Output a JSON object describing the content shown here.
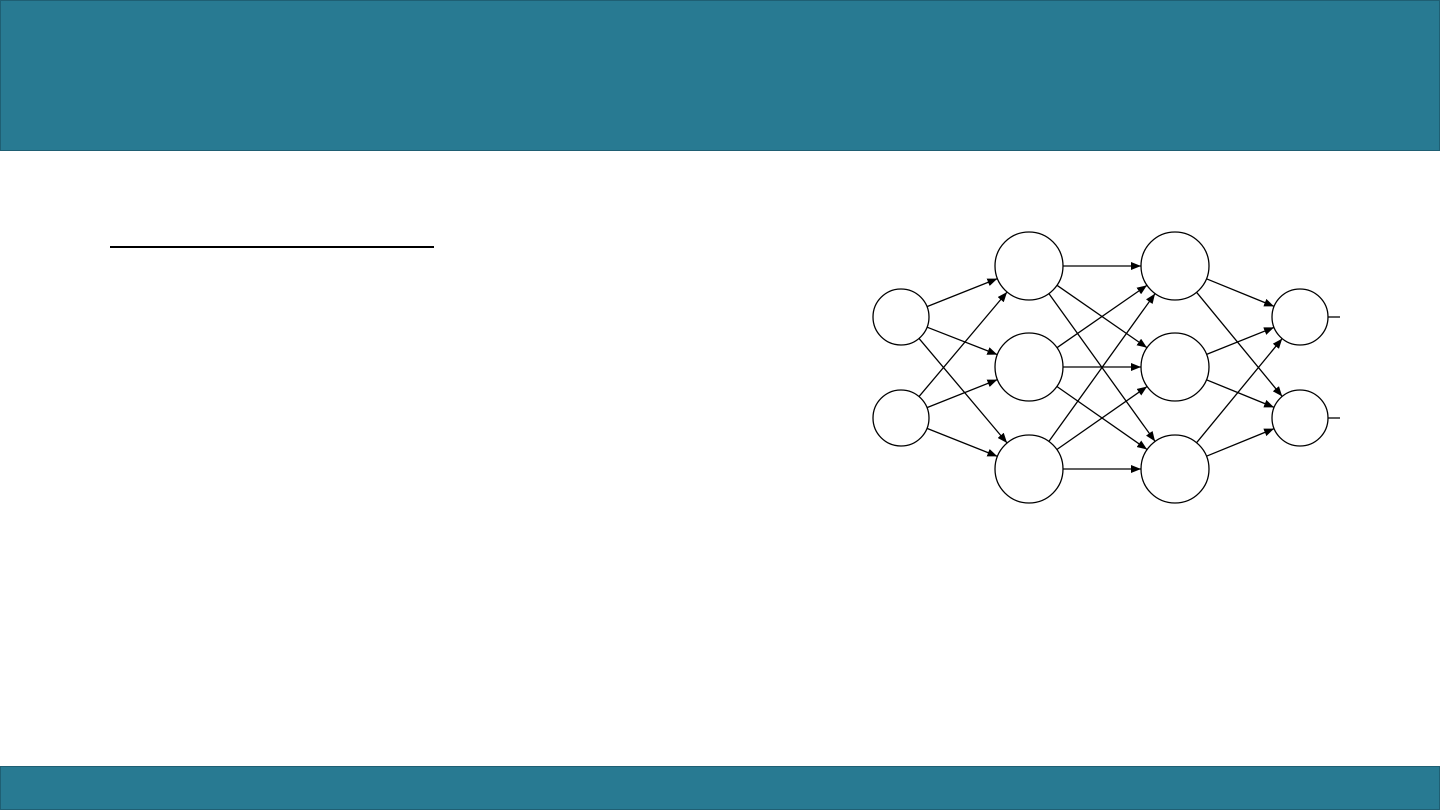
{
  "theme": {
    "bar_color": "#287a92",
    "rule_color": "#000000",
    "panel_color": "#ffffff"
  },
  "diagram": {
    "type": "feedforward-neural-network",
    "layers": [
      {
        "name": "input",
        "nodes": 2
      },
      {
        "name": "hidden-1",
        "nodes": 3
      },
      {
        "name": "hidden-2",
        "nodes": 3
      },
      {
        "name": "output",
        "nodes": 2
      }
    ],
    "connectivity": "fully-connected",
    "edge_style": "arrow",
    "output_stubs": true
  }
}
